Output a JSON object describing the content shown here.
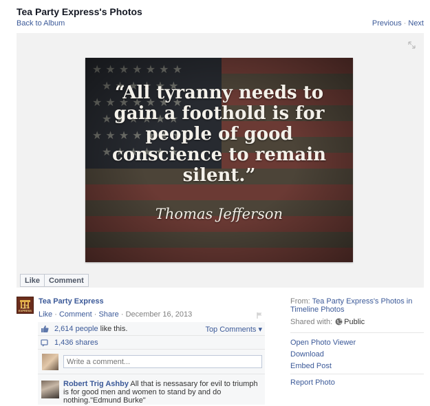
{
  "header": {
    "title": "Tea Party Express's Photos",
    "back_label": "Back to Album",
    "previous_label": "Previous",
    "separator": "·",
    "next_label": "Next"
  },
  "photo": {
    "quote": "“All tyranny needs to gain a foothold is for people of good conscience to remain silent.”",
    "author": "Thomas Jefferson"
  },
  "actions": {
    "like_label": "Like",
    "comment_label": "Comment"
  },
  "post": {
    "page_name": "Tea Party Express",
    "logo_text": "TEA PARTY EXPRESS",
    "like_label": "Like",
    "comment_label": "Comment",
    "share_label": "Share",
    "date": "December 16, 2013",
    "dot": " · "
  },
  "ufi": {
    "likes_count": "2,614 people",
    "likes_suffix": " like this.",
    "top_comments_label": "Top Comments ▾",
    "shares": "1,436 shares",
    "comment_placeholder": "Write a comment...",
    "comment": {
      "author": "Robert Trig Ashby",
      "text": " All that is nessasary for evil to triumph is for good men and women to stand by and do nothing.\"Edmund Burke\""
    }
  },
  "sidebar": {
    "from_label": "From: ",
    "from_link": "Tea Party Express's Photos in Timeline Photos",
    "shared_label": "Shared with:",
    "shared_value": "Public",
    "links": [
      "Open Photo Viewer",
      "Download",
      "Embed Post",
      "Report Photo"
    ]
  },
  "colors": {
    "link": "#3b5998",
    "stage_bg": "#f2f2f2"
  }
}
